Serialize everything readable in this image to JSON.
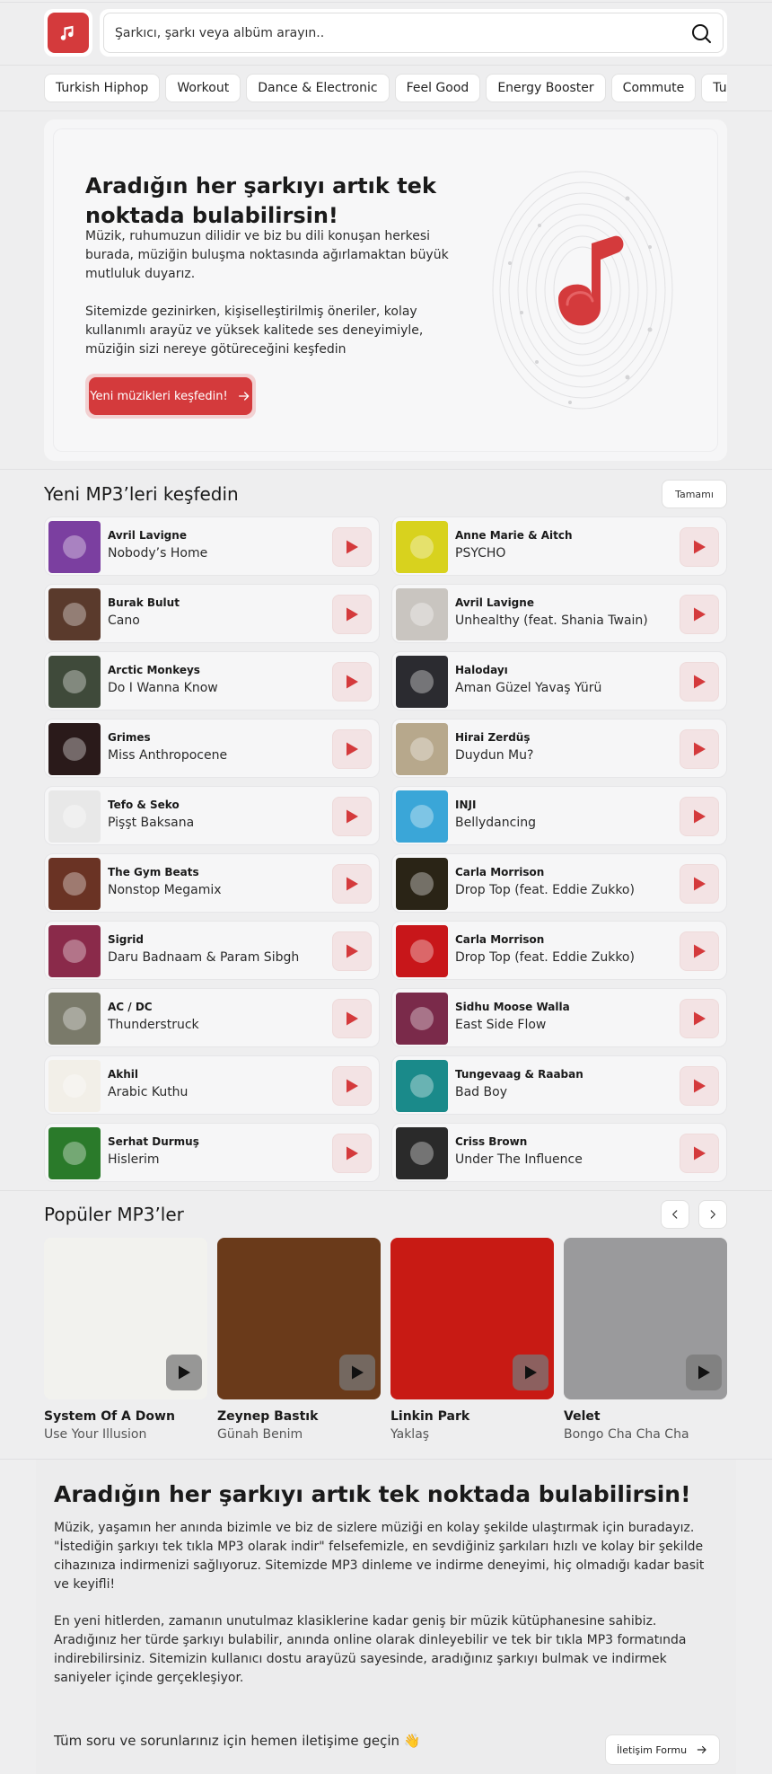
{
  "header": {
    "logo_icon": "music-note-icon",
    "search_placeholder": "Şarkıcı, şarkı veya albüm arayın.."
  },
  "genres": [
    "Turkish Hiphop",
    "Workout",
    "Dance & Electronic",
    "Feel Good",
    "Energy Booster",
    "Commute",
    "Turkish Indie"
  ],
  "hero": {
    "title": "Aradığın her şarkıyı artık tek noktada bulabilirsin!",
    "text1": "Müzik, ruhumuzun dilidir ve biz bu dili konuşan herkesi burada, müziğin buluşma noktasında ağırlamaktan büyük mutluluk duyarız.",
    "text2": "Sitemizde gezinirken, kişiselleştirilmiş öneriler, kolay kullanımlı arayüz ve yüksek kalitede ses deneyimiyle, müziğin sizi nereye götüreceğini keşfedin",
    "button": "Yeni müzikleri keşfedin!"
  },
  "new_section": {
    "title": "Yeni MP3’leri keşfedin",
    "see_all": "Tamamı"
  },
  "tracks": [
    {
      "artist": "Avril Lavigne",
      "title": "Nobody’s Home",
      "color": "#7b3fa0"
    },
    {
      "artist": "Anne Marie & Aitch",
      "title": "PSYCHO",
      "color": "#d8d21e"
    },
    {
      "artist": "Burak Bulut",
      "title": "Cano",
      "color": "#5a3a2c"
    },
    {
      "artist": "Avril Lavigne",
      "title": "Unhealthy (feat. Shania Twain)",
      "color": "#c9c5c0"
    },
    {
      "artist": "Arctic Monkeys",
      "title": "Do I Wanna Know",
      "color": "#3f4a3a"
    },
    {
      "artist": "Halodayı",
      "title": "Aman Güzel Yavaş Yürü",
      "color": "#2b2b30"
    },
    {
      "artist": "Grimes",
      "title": "Miss Anthropocene",
      "color": "#2a1a1a"
    },
    {
      "artist": "Hirai Zerdüş",
      "title": "Duydun Mu?",
      "color": "#b7a88c"
    },
    {
      "artist": "Tefo & Seko",
      "title": "Pişşt Baksana",
      "color": "#e8e8e8"
    },
    {
      "artist": "INJI",
      "title": "Bellydancing",
      "color": "#3aa6d8"
    },
    {
      "artist": "The Gym Beats",
      "title": "Nonstop Megamix",
      "color": "#6a3324"
    },
    {
      "artist": "Carla Morrison",
      "title": "Drop Top (feat. Eddie Zukko)",
      "color": "#2a2416"
    },
    {
      "artist": "Sigrid",
      "title": "Daru Badnaam & Param Sibgh",
      "color": "#8a2a4a"
    },
    {
      "artist": "Carla Morrison",
      "title": "Drop Top (feat. Eddie Zukko)",
      "color": "#c8161a"
    },
    {
      "artist": "AC / DC",
      "title": "Thunderstruck",
      "color": "#7a7a6a"
    },
    {
      "artist": "Sidhu Moose Walla",
      "title": "East Side Flow",
      "color": "#7a2a4a"
    },
    {
      "artist": "Akhil",
      "title": "Arabic Kuthu",
      "color": "#f2efe8"
    },
    {
      "artist": "Tungevaag & Raaban",
      "title": "Bad Boy",
      "color": "#1a8a8a"
    },
    {
      "artist": "Serhat Durmuş",
      "title": "Hislerim",
      "color": "#2a7a2a"
    },
    {
      "artist": "Criss Brown",
      "title": "Under The Influence",
      "color": "#2a2a2a"
    }
  ],
  "popular_section": {
    "title": "Popüler MP3’ler"
  },
  "popular": [
    {
      "artist": "System Of A Down",
      "title": "Use Your Illusion",
      "color": "#f2f2ee"
    },
    {
      "artist": "Zeynep Bastık",
      "title": "Günah Benim",
      "color": "#6a3a1a"
    },
    {
      "artist": "Linkin Park",
      "title": "Yaklaş",
      "color": "#c81a14"
    },
    {
      "artist": "Velet",
      "title": "Bongo Cha Cha Cha",
      "color": "#9a9a9c"
    }
  ],
  "about": {
    "title": "Aradığın her şarkıyı artık tek noktada bulabilirsin!",
    "p1": "Müzik, yaşamın her anında bizimle ve biz de sizlere müziği en kolay şekilde ulaştırmak için buradayız. \"İstediğin şarkıyı tek tıkla MP3 olarak indir\" felsefemizle, en sevdiğiniz şarkıları hızlı ve kolay bir şekilde cihazınıza indirmenizi sağlıyoruz. Sitemizde MP3 dinleme ve indirme deneyimi, hiç olmadığı kadar basit ve keyifli!",
    "p2": "En yeni hitlerden, zamanın unutulmaz klasiklerine kadar geniş bir müzik kütüphanesine sahibiz. Aradığınız her türde şarkıyı bulabilir, anında online olarak dinleyebilir ve tek bir tıkla MP3 formatında indirebilirsiniz. Sitemizin kullanıcı dostu arayüzü sayesinde, aradığınız şarkıyı bulmak ve indirmek saniyeler içinde gerçekleşiyor."
  },
  "contact": {
    "text": "Tüm soru ve sorunlarınız için hemen iletişime geçin 👋",
    "button": "İletişim Formu"
  },
  "colors": {
    "accent": "#d43a3c",
    "accent_soft": "#f3e3e4"
  }
}
